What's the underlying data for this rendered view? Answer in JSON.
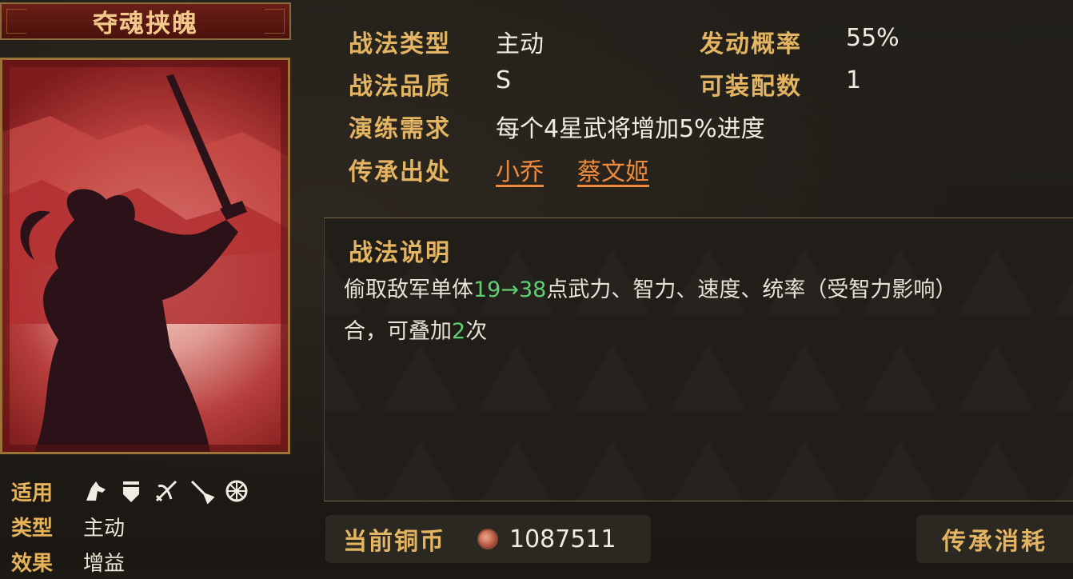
{
  "card": {
    "title": "夺魂挟魄"
  },
  "side": {
    "applicable_label": "适用",
    "applicable_icons": [
      "cavalry-icon",
      "shield-icon",
      "archer-icon",
      "spear-icon",
      "siege-icon"
    ],
    "type_label": "类型",
    "type_value": "主动",
    "effect_label": "效果",
    "effect_value": "增益"
  },
  "attributes": {
    "tactic_type_label": "战法类型",
    "tactic_type_value": "主动",
    "trigger_rate_label": "发动概率",
    "trigger_rate_value": "55%",
    "quality_label": "战法品质",
    "quality_value": "S",
    "equip_count_label": "可装配数",
    "equip_count_value": "1",
    "drill_label": "演练需求",
    "drill_value": "每个4星武将增加5%进度",
    "source_label": "传承出处",
    "source_links": [
      "小乔",
      "蔡文姬"
    ]
  },
  "description": {
    "title": "战法说明",
    "line1_a": "偷取敌军单体",
    "line1_hl": "19→38",
    "line1_b": "点武力、智力、速度、统率（受智力影响）",
    "line2_a": "合，可叠加",
    "line2_hl": "2",
    "line2_b": "次"
  },
  "footer": {
    "coin_label": "当前铜币",
    "coin_value": "1087511",
    "inherit_label": "传承消耗"
  }
}
